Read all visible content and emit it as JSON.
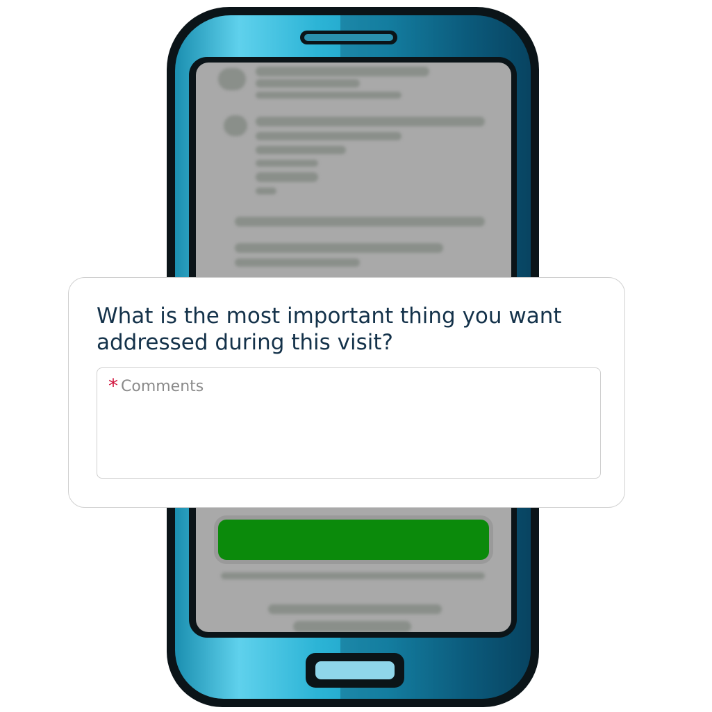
{
  "survey": {
    "question": "What is the most important thing you want addressed during this visit?",
    "comments_label": "Comments",
    "required_marker": "*"
  },
  "colors": {
    "accent_green": "#0b8a0b",
    "required_red": "#d0103a",
    "question_text": "#14324a",
    "phone_blue": "#2cb4d6"
  },
  "icons": {
    "speaker": "phone-speaker-icon",
    "home": "home-button-icon"
  }
}
